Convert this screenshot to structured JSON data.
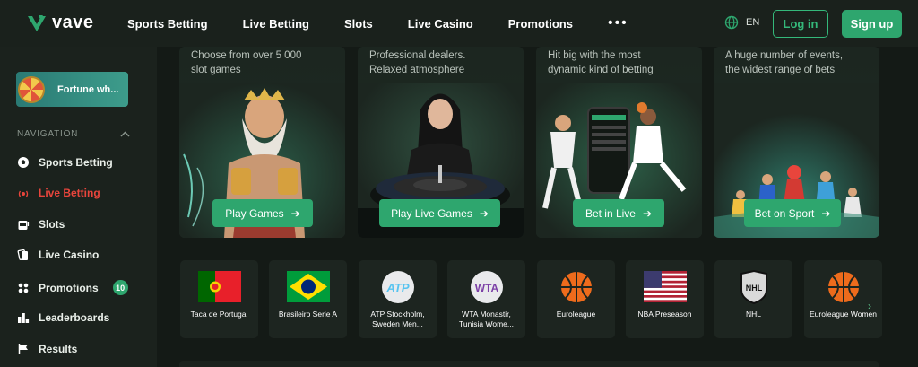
{
  "header": {
    "logo_text": "vave",
    "nav": [
      "Sports Betting",
      "Live Betting",
      "Slots",
      "Live Casino",
      "Promotions"
    ],
    "more_label": "•••",
    "language": "EN",
    "login_label": "Log in",
    "signup_label": "Sign up",
    "accent_color": "#2ea66e"
  },
  "sidebar": {
    "promo_banner_label": "Fortune wh...",
    "nav_header": "NAVIGATION",
    "items": [
      {
        "label": "Sports Betting",
        "icon": "soccer-ball-icon"
      },
      {
        "label": "Live Betting",
        "icon": "live-signal-icon",
        "active": true
      },
      {
        "label": "Slots",
        "icon": "slot-machine-icon"
      },
      {
        "label": "Live Casino",
        "icon": "cards-icon"
      },
      {
        "label": "Promotions",
        "icon": "gift-icon",
        "badge": "10"
      },
      {
        "label": "Leaderboards",
        "icon": "leaderboard-icon"
      },
      {
        "label": "Results",
        "icon": "flag-icon"
      }
    ]
  },
  "cards": [
    {
      "desc_line1": "Choose from over 5 000",
      "desc_line2": "slot games",
      "button": "Play Games"
    },
    {
      "desc_line1": "Professional dealers.",
      "desc_line2": "Relaxed atmosphere",
      "button": "Play Live Games"
    },
    {
      "desc_line1": "Hit big with the most",
      "desc_line2": "dynamic kind of betting",
      "button": "Bet in Live"
    },
    {
      "desc_line1": "A huge number of events,",
      "desc_line2": "the widest range of bets",
      "button": "Bet on Sport"
    }
  ],
  "sports": [
    {
      "label": "Taca de Portugal",
      "icon": "portugal-flag-icon"
    },
    {
      "label": "Brasileiro Serie A",
      "icon": "brazil-flag-icon"
    },
    {
      "label": "ATP Stockholm, Sweden Men...",
      "icon": "atp-logo-icon"
    },
    {
      "label": "WTA Monastir, Tunisia Wome...",
      "icon": "wta-logo-icon"
    },
    {
      "label": "Euroleague",
      "icon": "basketball-icon"
    },
    {
      "label": "NBA Preseason",
      "icon": "usa-flag-icon"
    },
    {
      "label": "NHL",
      "icon": "nhl-logo-icon"
    },
    {
      "label": "Euroleague Women",
      "icon": "basketball-icon"
    }
  ],
  "scroll_arrow": "›"
}
